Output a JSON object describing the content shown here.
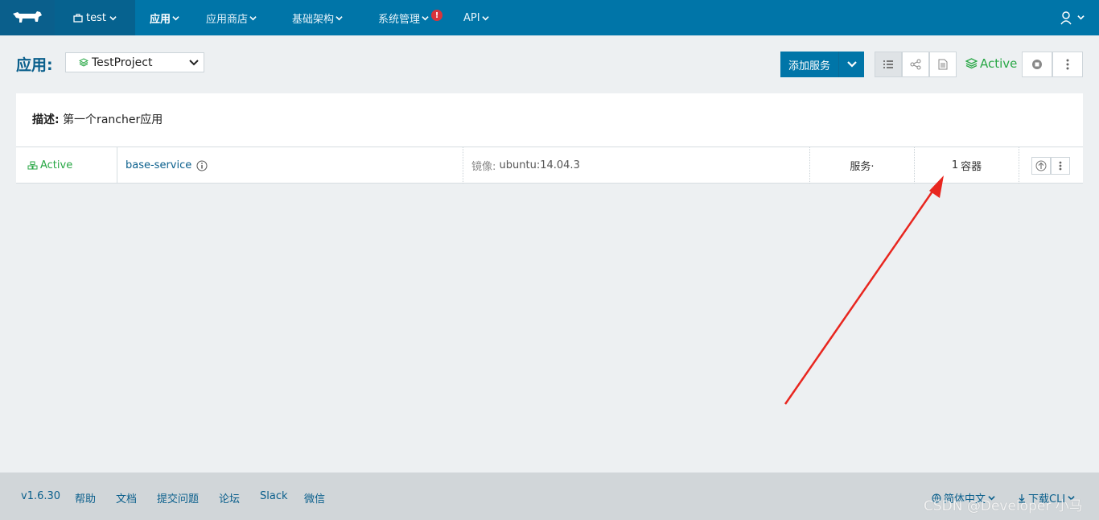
{
  "topbar": {
    "environment": "test",
    "nav": [
      "应用",
      "应用商店",
      "基础架构",
      "系统管理",
      "API"
    ],
    "alert_badge": "!"
  },
  "header": {
    "title": "应用:",
    "project": "TestProject",
    "add_service": "添加服务",
    "state": "Active"
  },
  "description": {
    "label": "描述:",
    "text": "第一个rancher应用"
  },
  "service_row": {
    "state": "Active",
    "name": "base-service",
    "image_label": "镜像:",
    "image": "ubuntu:14.04.3",
    "type": "服务·",
    "count": "1",
    "count_label": "容器"
  },
  "footer": {
    "version": "v1.6.30",
    "links": [
      "帮助",
      "文档",
      "提交问题",
      "论坛",
      "Slack",
      "微信"
    ],
    "language": "简体中文",
    "download": "下载CLI"
  },
  "watermark": "CSDN @Developer 小马",
  "colors": {
    "topbar": "#0075a8",
    "accent": "#0a5f8c",
    "active_green": "#28a745",
    "annotation_arrow": "#e8261f"
  }
}
